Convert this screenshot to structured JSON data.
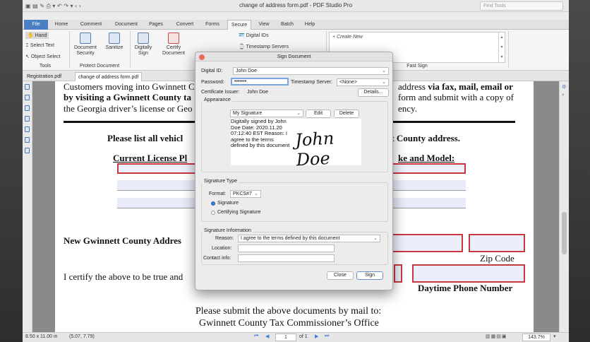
{
  "window": {
    "title": "change of address form.pdf - PDF Studio Pro",
    "find_tools_placeholder": "Find Tools"
  },
  "menu_tabs": [
    "File",
    "Home",
    "Comment",
    "Document",
    "Pages",
    "Convert",
    "Forms",
    "Secure",
    "View",
    "Batch",
    "Help"
  ],
  "ribbon": {
    "tools_group": {
      "title": "Tools",
      "hand": "Hand",
      "select_text": "Select Text",
      "object_select": "Object Select"
    },
    "protect_group": {
      "title": "Protect Document",
      "document_security": "Document Security",
      "sanitize": "Sanitize"
    },
    "sign_group": {
      "digitally_sign": "Digitally Sign",
      "certify_document": "Certify Document",
      "digital_ids": "Digital IDs",
      "timestamp_servers": "Timestamp Servers"
    },
    "fast_sign": {
      "title": "Fast Sign",
      "create_new": "+ Create New"
    }
  },
  "doc_tabs": [
    "Registration.pdf",
    "change of address form.pdf"
  ],
  "document": {
    "line1": "Customers moving into Gwinnett C",
    "line1_right": "address ",
    "line1_right_bold": "via fax, mail, email or",
    "line2_bold": "by visiting a Gwinnett County ta",
    "line2_right": "form and submit with a copy of",
    "line3": "the Georgia driver’s license or Geo",
    "line3_right": "ency.",
    "heading": "Please list all vehicl",
    "heading_right": "tt County address.",
    "col_plate": "Current License Pl",
    "col_make": "ke and Model:",
    "new_address": "New Gwinnett County Addres",
    "zip_code": "Zip Code",
    "certify": "I certify the above to be true and",
    "daytime_phone": "Daytime Phone Number",
    "submit1": "Please submit the above documents by mail to:",
    "submit2": "Gwinnett County Tax Commissioner’s Office"
  },
  "status": {
    "page_size": "8.50 x 11.00 in",
    "coords": "(5.07, 7.79)",
    "page_number": "1",
    "page_of": "of 1",
    "zoom": "143.7%"
  },
  "dialog": {
    "title": "Sign Document",
    "digital_id_label": "Digital ID:",
    "digital_id_value": "John Doe",
    "password_label": "Password:",
    "password_value": "•••••••",
    "timestamp_label": "Timestamp Server:",
    "timestamp_value": "<None>",
    "issuer_label": "Certificate Issuer:",
    "issuer_value": "John Doe",
    "details_button": "Details...",
    "appearance_label": "Appearance",
    "appearance_value": "My Signature",
    "edit_button": "Edit",
    "delete_button": "Delete",
    "preview_text": "Digitally signed by John Doe Date: 2020.11.20 07:12:40 EST Reason: I agree to the terms defined by this document",
    "preview_signature": "John Doe",
    "signature_type_label": "Signature Type",
    "format_label": "Format:",
    "format_value": "PKCS#7",
    "radio_signature": "Signature",
    "radio_certifying": "Certifying Signature",
    "sig_info_label": "Signature Information",
    "reason_label": "Reason:",
    "reason_value": "I agree to the terms defined by this document",
    "location_label": "Location:",
    "contact_label": "Contact info:",
    "close_button": "Close",
    "sign_button": "Sign"
  }
}
